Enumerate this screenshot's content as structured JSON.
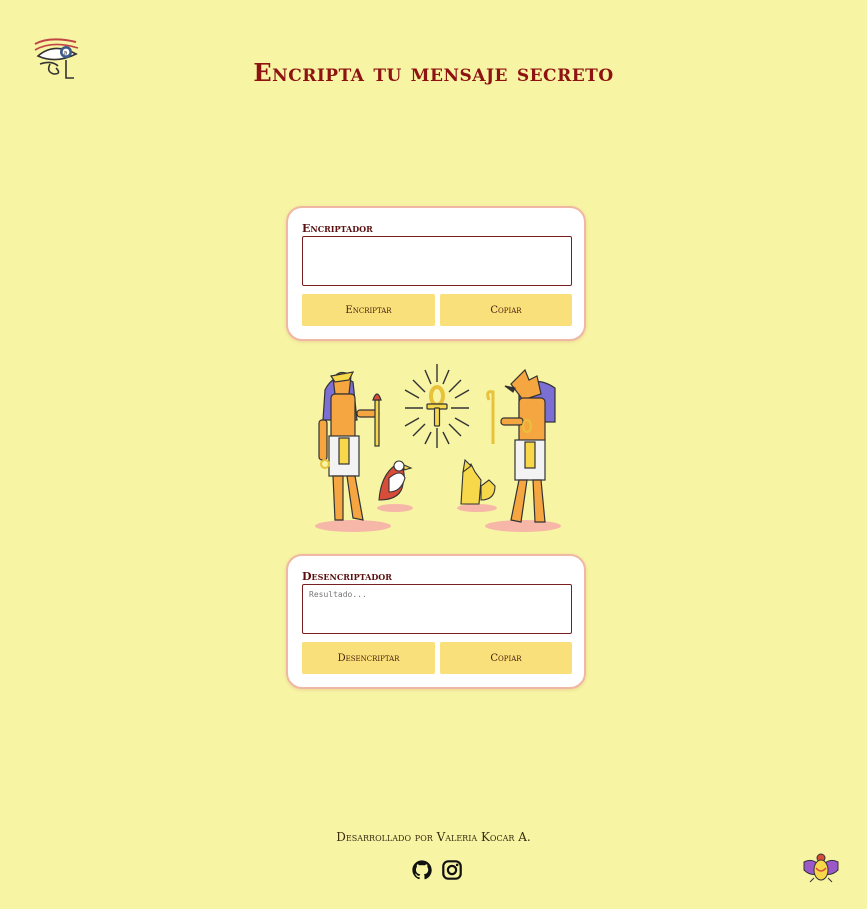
{
  "header": {
    "title": "Encripta tu mensaje secreto",
    "logo_icon": "eye-of-horus-icon"
  },
  "encrypt_card": {
    "label": "Encriptador",
    "input_value": "",
    "input_placeholder": "",
    "encrypt_button": "Encriptar",
    "copy_button": "Copiar"
  },
  "illustration": {
    "icon": "egyptian-gods-ankh-illustration"
  },
  "decrypt_card": {
    "label": "Desencriptador",
    "input_value": "",
    "input_placeholder": "Resultado...",
    "decrypt_button": "Desencriptar",
    "copy_button": "Copiar"
  },
  "footer": {
    "credit": "Desarrollado por Valeria Kocar A.",
    "github_icon": "github-icon",
    "instagram_icon": "instagram-icon",
    "corner_icon": "scarab-icon"
  },
  "colors": {
    "background": "#f7f4a4",
    "title": "#8e1212",
    "button": "#f9e07a",
    "card_border": "#f0b7a4"
  }
}
